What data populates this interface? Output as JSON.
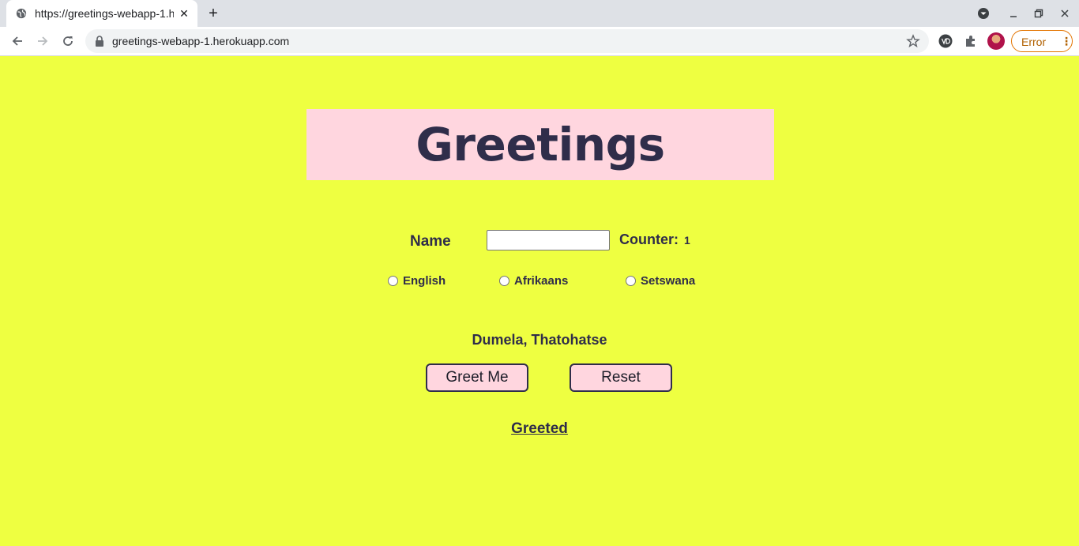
{
  "browser": {
    "tab_title": "https://greetings-webapp-1.herokuapp.com",
    "tab_close": "✕",
    "new_tab": "+",
    "url": "greetings-webapp-1.herokuapp.com",
    "profile_status": "Error",
    "icons": {
      "back": "arrow-left-icon",
      "forward": "arrow-right-icon",
      "reload": "reload-icon",
      "lock": "lock-icon",
      "bookmark": "star-icon",
      "extension": "puzzle-icon",
      "tab_search": "chevron-down-icon"
    },
    "accent_error": "#e37400"
  },
  "page": {
    "title": "Greetings",
    "name_label": "Name",
    "name_value": "",
    "counter_label": "Counter:",
    "counter_value": "1",
    "languages": [
      "English",
      "Afrikaans",
      "Setswana"
    ],
    "greeting_message": "Dumela, Thatohatse",
    "greet_button": "Greet Me",
    "reset_button": "Reset",
    "greeted_link": "Greeted",
    "colors": {
      "background": "#eeff41",
      "banner": "#ffd6df",
      "text": "#2f2d4a"
    }
  }
}
